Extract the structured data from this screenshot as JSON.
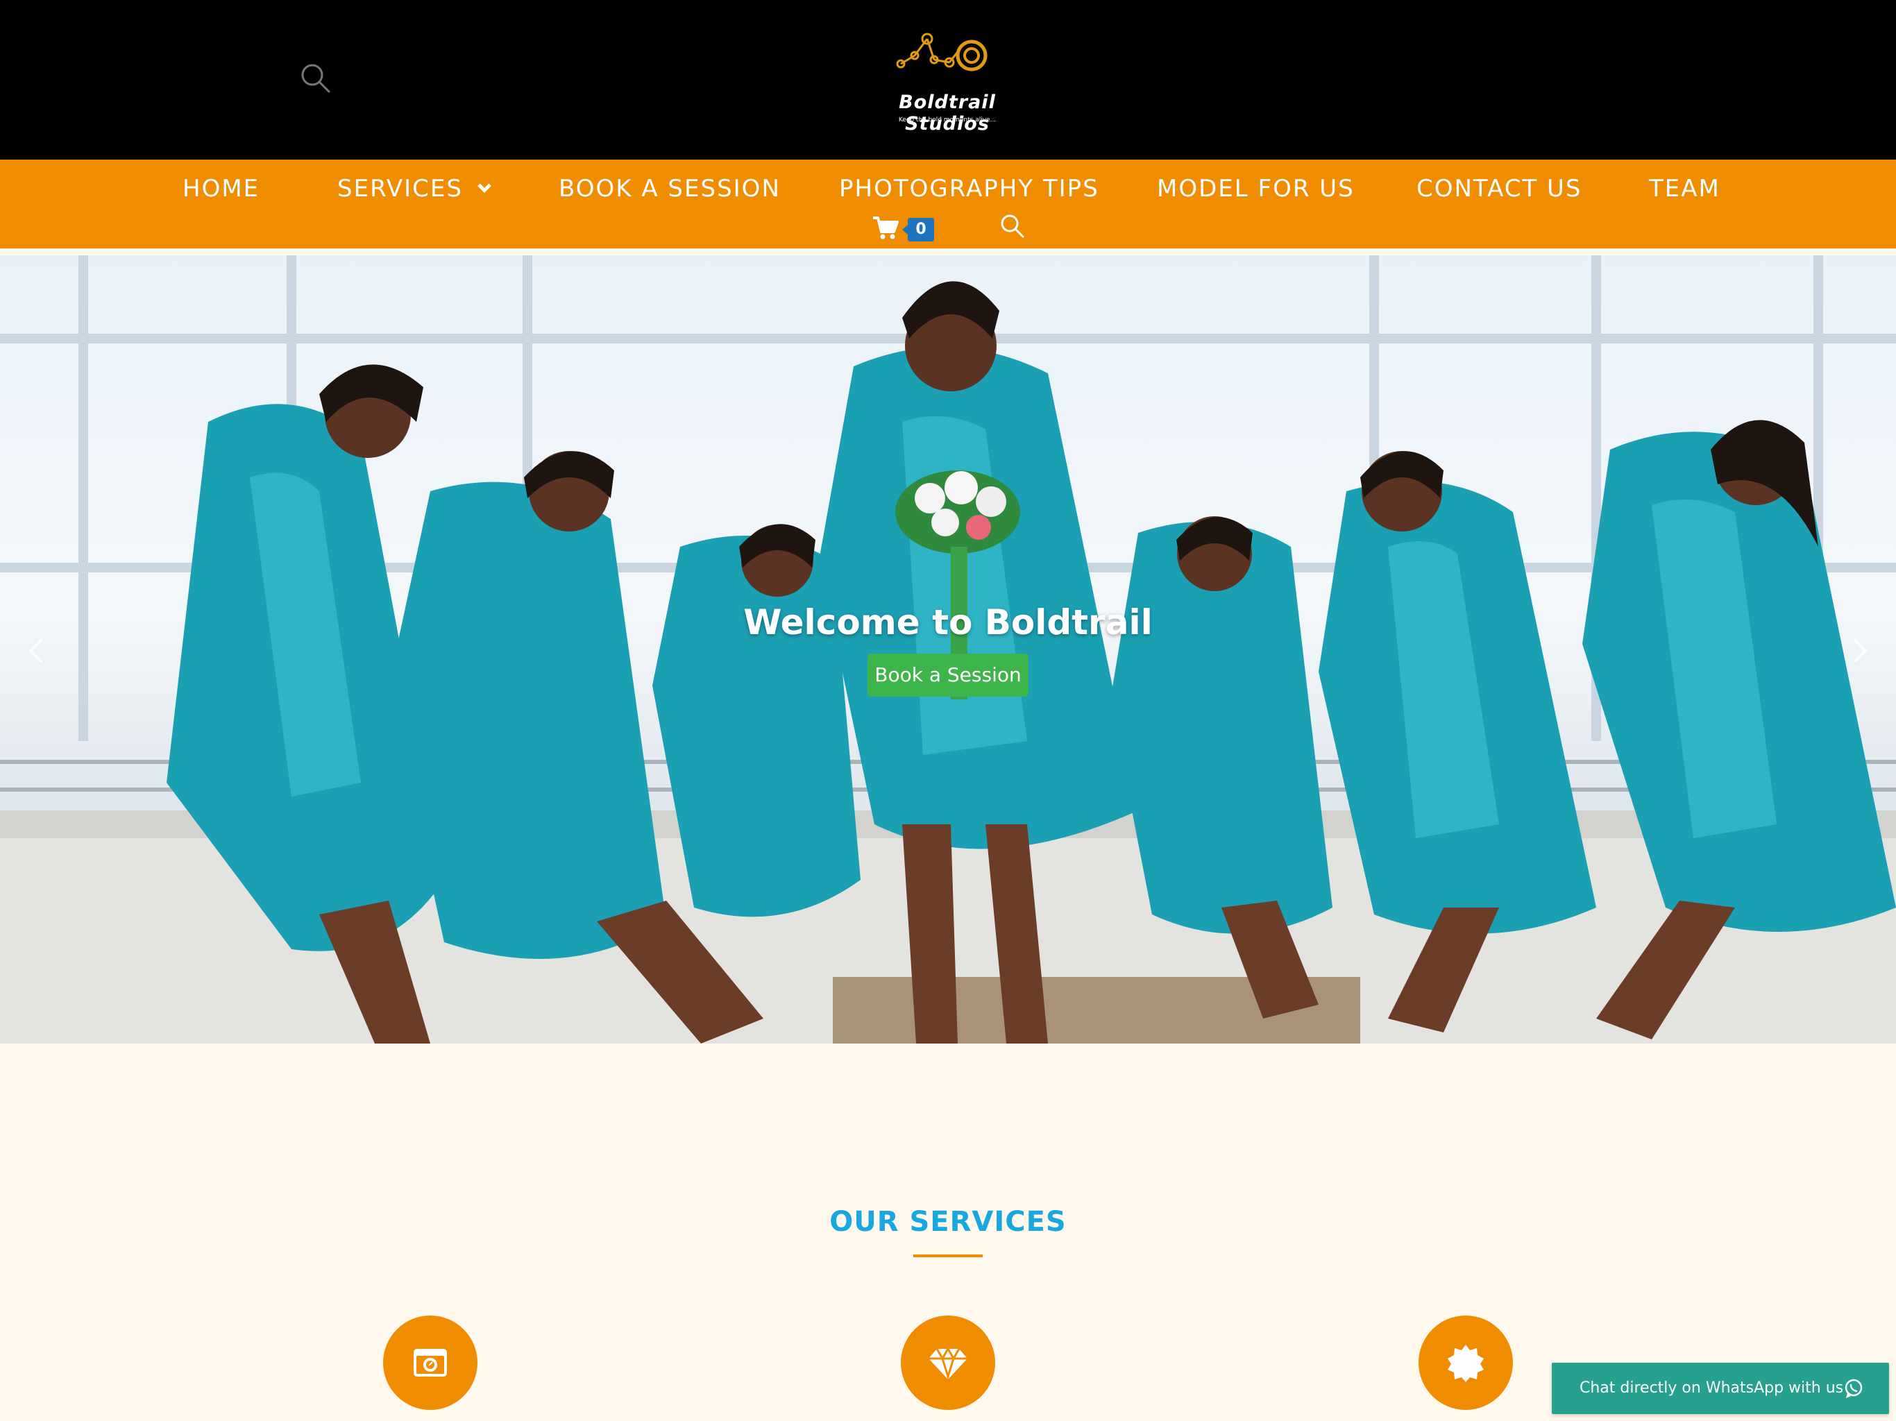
{
  "brand": {
    "name": "Boldtrail Studios",
    "tagline": "Keep the bold moments alive..."
  },
  "nav": {
    "items": [
      {
        "label": "HOME"
      },
      {
        "label": "SERVICES"
      },
      {
        "label": "BOOK A SESSION"
      },
      {
        "label": "PHOTOGRAPHY TIPS"
      },
      {
        "label": "MODEL FOR US"
      },
      {
        "label": "CONTACT US"
      },
      {
        "label": "TEAM"
      }
    ],
    "cart_count": "0"
  },
  "hero": {
    "title": "Welcome to Boldtrail",
    "button_label": "Book a Session"
  },
  "services": {
    "title": "OUR SERVICES",
    "icons": [
      "camera-icon",
      "diamond-icon",
      "badge-icon"
    ]
  },
  "whatsapp": {
    "label": "Chat directly on WhatsApp with us"
  },
  "colors": {
    "header_bg": "#000000",
    "nav_bg": "#ef8c00",
    "accent_blue": "#19a7e0",
    "button_green": "#3eb54a",
    "whatsapp_green": "#25a18e",
    "page_bg": "#fff8ec"
  }
}
